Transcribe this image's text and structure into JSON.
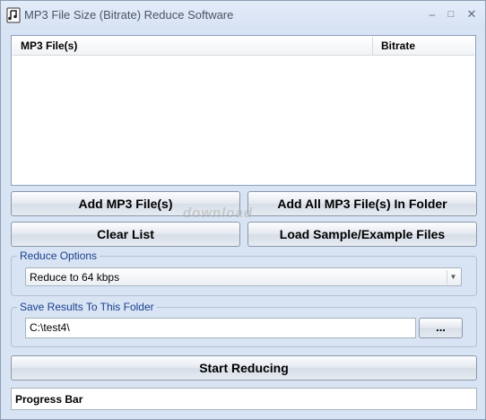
{
  "window": {
    "title": "MP3 File Size (Bitrate) Reduce Software"
  },
  "file_list": {
    "columns": [
      "MP3 File(s)",
      "Bitrate"
    ],
    "rows": []
  },
  "buttons": {
    "add_files": "Add MP3 File(s)",
    "add_folder": "Add All MP3 File(s) In Folder",
    "clear_list": "Clear List",
    "load_samples": "Load Sample/Example Files",
    "browse": "...",
    "start": "Start Reducing"
  },
  "reduce_options": {
    "label": "Reduce Options",
    "selected": "Reduce to 64 kbps"
  },
  "save_folder": {
    "label": "Save Results To This Folder",
    "value": "C:\\test4\\"
  },
  "progress": {
    "label": "Progress Bar",
    "value": 0
  },
  "watermark": {
    "text": "download"
  }
}
